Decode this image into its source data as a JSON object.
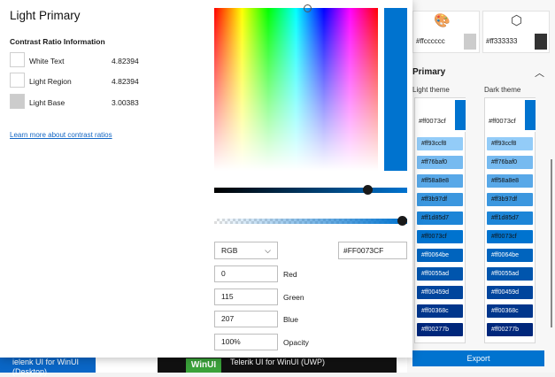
{
  "flyout": {
    "title": "Light Primary",
    "contrast_header": "Contrast Ratio Information",
    "rows": [
      {
        "label": "White Text",
        "value": "4.82394",
        "color": "#ffffff"
      },
      {
        "label": "Light Region",
        "value": "4.82394",
        "color": "#ffffff"
      },
      {
        "label": "Light Base",
        "value": "3.00383",
        "color": "#cccccc"
      }
    ],
    "learn_more": "Learn more about contrast ratios",
    "picker": {
      "preview_color": "#0073cf",
      "mode": "RGB",
      "hex": "#FF0073CF",
      "fields": [
        {
          "value": "0",
          "label": "Red"
        },
        {
          "value": "115",
          "label": "Green"
        },
        {
          "value": "207",
          "label": "Blue"
        },
        {
          "value": "100%",
          "label": "Opacity"
        }
      ]
    }
  },
  "background": {
    "swatches": [
      {
        "icon": "palette-icon",
        "hex": "#ffcccccc",
        "color": "#cccccc"
      },
      {
        "icon": "cube-icon",
        "hex": "#ff333333",
        "color": "#333333"
      }
    ],
    "section_title": "Primary",
    "light_theme_label": "Light theme",
    "dark_theme_label": "Dark theme",
    "base_hex": "#ff0073cf",
    "light_chips": [
      {
        "hex": "#ff93ccf8",
        "color": "#93ccf8"
      },
      {
        "hex": "#ff76baf0",
        "color": "#76baf0"
      },
      {
        "hex": "#ff58a8e8",
        "color": "#58a8e8"
      },
      {
        "hex": "#ff3b97df",
        "color": "#3b97df"
      },
      {
        "hex": "#ff1d85d7",
        "color": "#1d85d7"
      },
      {
        "hex": "#ff0073cf",
        "color": "#0073cf"
      },
      {
        "hex": "#ff0064be",
        "color": "#0064be"
      },
      {
        "hex": "#ff0055ad",
        "color": "#0055ad"
      },
      {
        "hex": "#ff00459d",
        "color": "#00459d"
      },
      {
        "hex": "#ff00368c",
        "color": "#00368c"
      },
      {
        "hex": "#ff00277b",
        "color": "#00277b"
      }
    ],
    "dark_chips": [
      {
        "hex": "#ff93ccf8",
        "color": "#93ccf8"
      },
      {
        "hex": "#ff76baf0",
        "color": "#76baf0"
      },
      {
        "hex": "#ff58a8e8",
        "color": "#58a8e8"
      },
      {
        "hex": "#ff3b97df",
        "color": "#3b97df"
      },
      {
        "hex": "#ff1d85d7",
        "color": "#1d85d7"
      },
      {
        "hex": "#ff0073cf",
        "color": "#0073cf"
      },
      {
        "hex": "#ff0064be",
        "color": "#0064be"
      },
      {
        "hex": "#ff0055ad",
        "color": "#0055ad"
      },
      {
        "hex": "#ff00459d",
        "color": "#00459d"
      },
      {
        "hex": "#ff00368c",
        "color": "#00368c"
      },
      {
        "hex": "#ff00277b",
        "color": "#00277b"
      }
    ],
    "export_label": "Export",
    "bottom_left_text": "ielenk UI for WinUI (Desktop)",
    "winui_label": "WinUI",
    "bottom_right_text": "Telerik UI for WinUI (UWP)"
  }
}
